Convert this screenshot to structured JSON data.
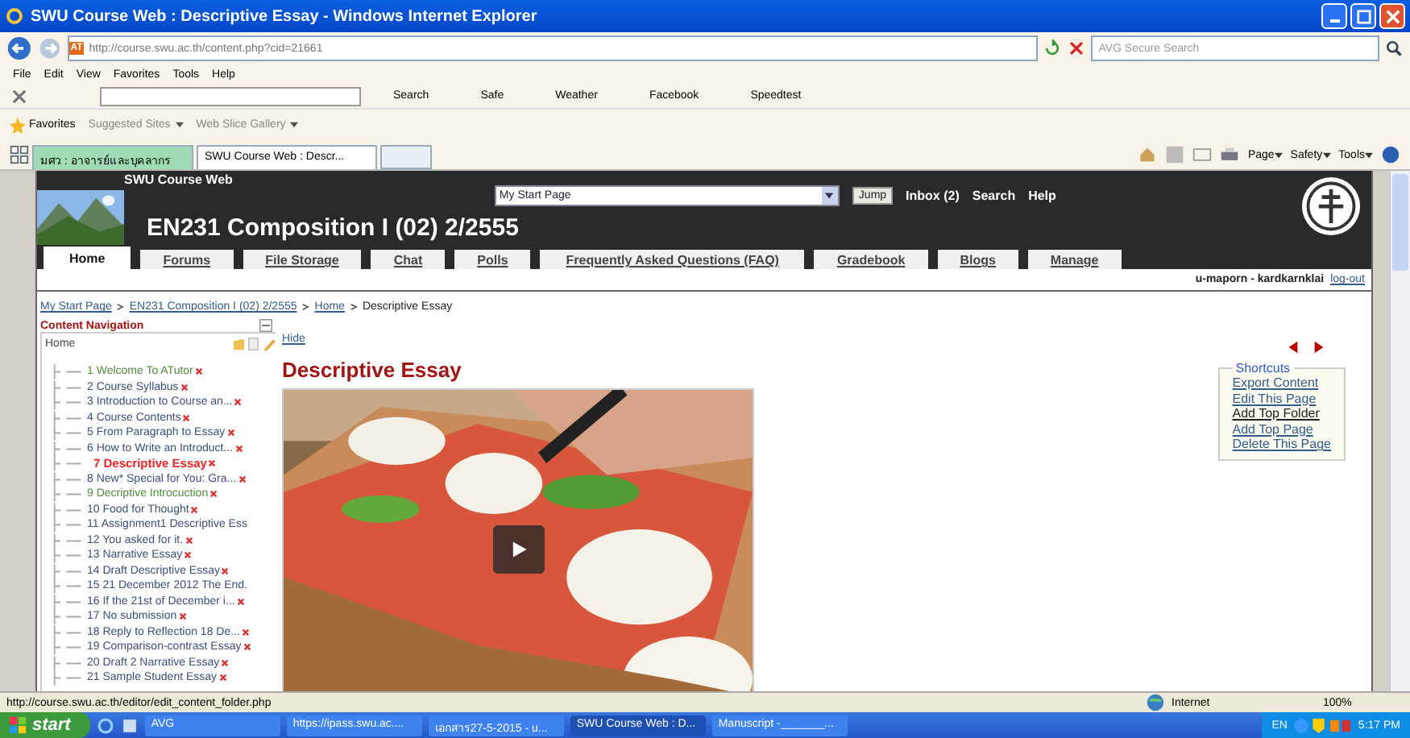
{
  "window": {
    "title": "SWU Course Web : Descriptive Essay - Windows Internet Explorer"
  },
  "address": {
    "favicon": "AT",
    "url": "http://course.swu.ac.th/content.php?cid=21661",
    "search_placeholder": "AVG Secure Search"
  },
  "menu": [
    "File",
    "Edit",
    "View",
    "Favorites",
    "Tools",
    "Help"
  ],
  "search_toolbar": {
    "button": "Search",
    "links": [
      "Safe",
      "Weather",
      "Facebook",
      "Speedtest"
    ]
  },
  "favorites": {
    "label": "Favorites",
    "links": [
      "Suggested Sites",
      "Web Slice Gallery"
    ]
  },
  "tabs": [
    {
      "label": "มศว : อาจารย์และบุคลากร",
      "selected": false
    },
    {
      "label": "SWU Course Web : Descr...",
      "selected": true
    }
  ],
  "command_bar": [
    "Page",
    "Safety",
    "Tools"
  ],
  "site": {
    "name": "SWU Course Web",
    "course": "EN231 Composition I (02) 2/2555",
    "jump_value": "My Start Page",
    "jump_button": "Jump",
    "links": [
      "Inbox (2)",
      "Search",
      "Help"
    ],
    "nav": [
      {
        "label": "Home",
        "selected": true
      },
      {
        "label": "Forums",
        "selected": false
      },
      {
        "label": "File Storage",
        "selected": false
      },
      {
        "label": "Chat",
        "selected": false
      },
      {
        "label": "Polls",
        "selected": false
      },
      {
        "label": "Frequently Asked Questions (FAQ)",
        "selected": false
      },
      {
        "label": "Gradebook",
        "selected": false
      },
      {
        "label": "Blogs",
        "selected": false
      },
      {
        "label": "Manage",
        "selected": false
      }
    ],
    "user": "u-maporn - kardkarnklai",
    "logout": "log-out"
  },
  "breadcrumb": [
    "My Start Page",
    "EN231 Composition I (02) 2/2555",
    "Home",
    "Descriptive Essay"
  ],
  "sidebar": {
    "title": "Content Navigation",
    "root": "Home",
    "items": [
      {
        "label": "1 Welcome To ATutor",
        "visited": true,
        "selected": false,
        "deletable": true
      },
      {
        "label": "2 Course Syllabus",
        "visited": false,
        "selected": false,
        "deletable": true
      },
      {
        "label": "3 Introduction to Course an...",
        "visited": false,
        "selected": false,
        "deletable": true
      },
      {
        "label": "4 Course Contents",
        "visited": false,
        "selected": false,
        "deletable": true
      },
      {
        "label": "5 From Paragraph to Essay",
        "visited": false,
        "selected": false,
        "deletable": true
      },
      {
        "label": "6 How to Write an Introduct...",
        "visited": false,
        "selected": false,
        "deletable": true
      },
      {
        "label": "7 Descriptive Essay",
        "visited": false,
        "selected": true,
        "deletable": true
      },
      {
        "label": "8 New* Special for You: Gra...",
        "visited": false,
        "selected": false,
        "deletable": true
      },
      {
        "label": "9 Decriptive Introcuction",
        "visited": true,
        "selected": false,
        "deletable": true
      },
      {
        "label": "10 Food for Thought",
        "visited": false,
        "selected": false,
        "deletable": true
      },
      {
        "label": "11 Assignment1 Descriptive Ess",
        "visited": false,
        "selected": false,
        "deletable": false
      },
      {
        "label": "12 You asked for it.",
        "visited": false,
        "selected": false,
        "deletable": true
      },
      {
        "label": "13 Narrative Essay",
        "visited": false,
        "selected": false,
        "deletable": true
      },
      {
        "label": "14 Draft Descriptive Essay",
        "visited": false,
        "selected": false,
        "deletable": true
      },
      {
        "label": "15 21 December 2012 The End.",
        "visited": false,
        "selected": false,
        "deletable": false
      },
      {
        "label": "16 If the 21st of December i...",
        "visited": false,
        "selected": false,
        "deletable": true
      },
      {
        "label": "17 No submission",
        "visited": false,
        "selected": false,
        "deletable": true
      },
      {
        "label": "18 Reply to Reflection 18 De...",
        "visited": false,
        "selected": false,
        "deletable": true
      },
      {
        "label": "19 Comparison-contrast Essay",
        "visited": false,
        "selected": false,
        "deletable": true
      },
      {
        "label": "20 Draft 2 Narrative Essay",
        "visited": false,
        "selected": false,
        "deletable": true
      },
      {
        "label": "21 Sample Student Essay",
        "visited": false,
        "selected": false,
        "deletable": true
      }
    ]
  },
  "hide": "Hide",
  "heading": "Descriptive Essay",
  "video": {
    "kind": "picture"
  },
  "shortcuts": {
    "title": "Shortcuts",
    "links": [
      {
        "label": "Export Content",
        "hovered": false
      },
      {
        "label": "Edit This Page",
        "hovered": false
      },
      {
        "label": "Add Top Folder",
        "hovered": true
      },
      {
        "label": "Add Top Page",
        "hovered": false
      },
      {
        "label": "Delete This Page",
        "hovered": false
      }
    ]
  },
  "status_bar": {
    "url": "http://course.swu.ac.th/editor/edit_content_folder.php",
    "zone": "Internet",
    "zoom": "100%"
  },
  "taskbar": {
    "start": "start",
    "tasks": [
      {
        "label": "AVG",
        "selected": false
      },
      {
        "label": "https://ipass.swu.ac....",
        "selected": false
      },
      {
        "label": "เอกสาร27-5-2015 - u...",
        "selected": false
      },
      {
        "label": "SWU Course Web : D...",
        "selected": true
      },
      {
        "label": "Manuscript -_______...",
        "selected": false
      }
    ],
    "lang": "EN",
    "clock": "5:17 PM"
  }
}
